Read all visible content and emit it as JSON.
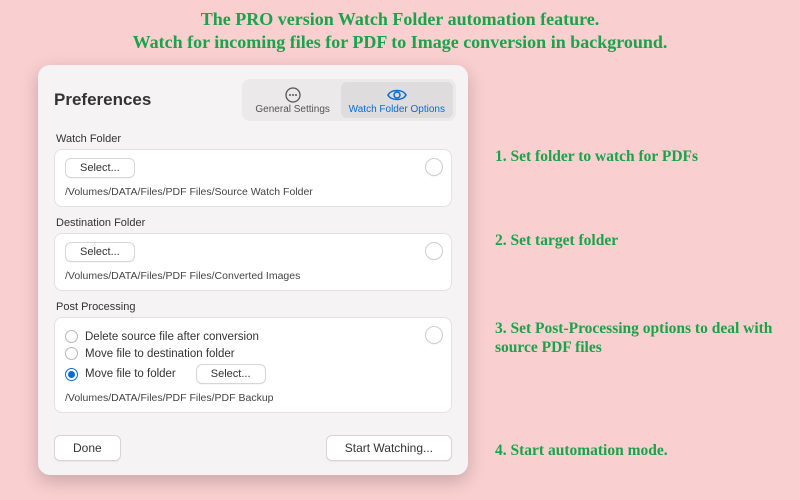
{
  "headline": {
    "line1": "The PRO version Watch Folder automation feature.",
    "line2": "Watch for incoming files for PDF to Image conversion in background."
  },
  "prefs": {
    "title": "Preferences",
    "tabs": {
      "general": "General Settings",
      "watch": "Watch Folder Options"
    },
    "select_label": "Select...",
    "watch_folder": {
      "label": "Watch Folder",
      "path": "/Volumes/DATA/Files/PDF Files/Source Watch Folder"
    },
    "dest_folder": {
      "label": "Destination Folder",
      "path": "/Volumes/DATA/Files/PDF Files/Converted Images"
    },
    "post": {
      "label": "Post Processing",
      "opt_delete": "Delete source file after conversion",
      "opt_move_dest": "Move file to destination folder",
      "opt_move_folder": "Move file to folder",
      "path": "/Volumes/DATA/Files/PDF Files/PDF Backup"
    },
    "footer": {
      "done": "Done",
      "start": "Start Watching..."
    }
  },
  "annotations": {
    "a1": "1. Set folder to watch for PDFs",
    "a2": "2. Set target folder",
    "a3": "3. Set Post-Processing options to deal with source PDF files",
    "a4": "4. Start automation mode."
  }
}
